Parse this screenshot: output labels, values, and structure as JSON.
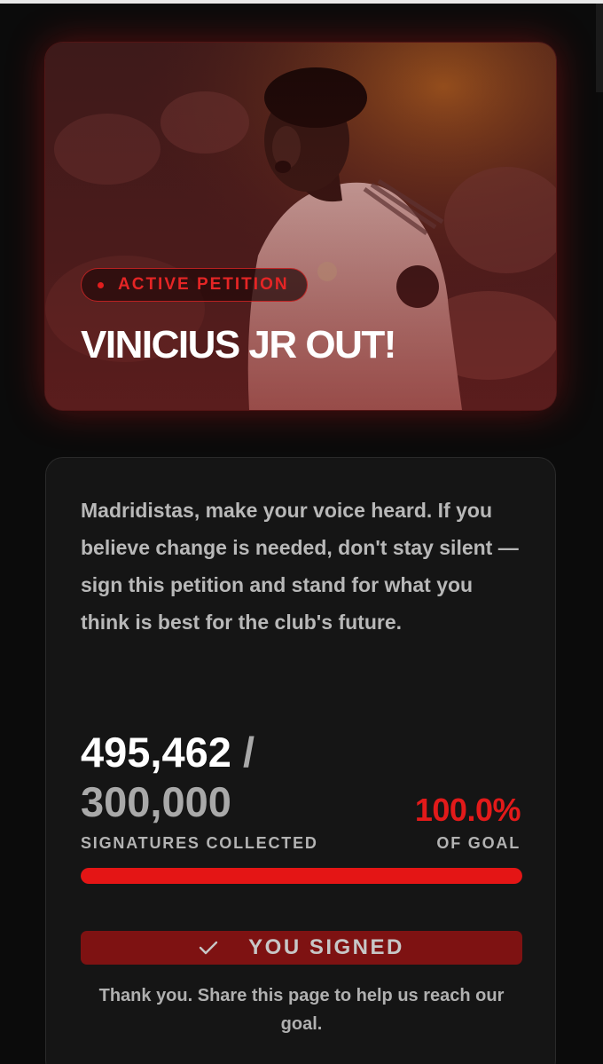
{
  "hero": {
    "status_label": "ACTIVE PETITION",
    "title": "VINICIUS JR OUT!",
    "image": "football-player-photo"
  },
  "petition": {
    "description": "Madridistas, make your voice heard. If you believe change is needed, don't stay silent — sign this petition and stand for what you think is best for the club's future.",
    "signatures": "495,462",
    "separator": "/",
    "goal": "300,000",
    "signatures_label": "SIGNATURES COLLECTED",
    "percent": "100.0%",
    "percent_label": "OF GOAL",
    "progress_fraction": 1.0
  },
  "action": {
    "signed_label": "YOU SIGNED",
    "signed_icon": "checkmark-icon",
    "thank_you": "Thank you. Share this page to help us reach our goal."
  },
  "colors": {
    "accent_red": "#e21a1a",
    "button_red": "#7e1212",
    "card_bg": "#151515",
    "page_bg": "#0b0b0b"
  }
}
